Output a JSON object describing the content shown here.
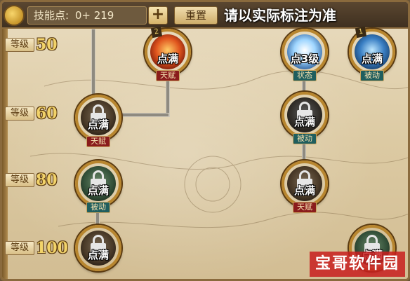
{
  "header": {
    "skill_points_label": "技能点:",
    "skill_points_value": "0+ 219",
    "plus_label": "+",
    "reset_label": "重置",
    "note": "请以实际标注为准"
  },
  "levels": [
    {
      "tag": "等级",
      "value": "50"
    },
    {
      "tag": "等级",
      "value": "60"
    },
    {
      "tag": "等级",
      "value": "80"
    },
    {
      "tag": "等级",
      "value": "100"
    }
  ],
  "skills": [
    {
      "id": "fire-talent",
      "label": "点满",
      "type": "天赋",
      "rank": "2",
      "icon": "fire-icon"
    },
    {
      "id": "ice-state",
      "label": "点3级",
      "type": "状态",
      "rank": "",
      "icon": "ice-burst-icon"
    },
    {
      "id": "blue-passive",
      "label": "点满",
      "type": "被动",
      "rank": "1",
      "icon": "blue-slash-icon"
    },
    {
      "id": "lv60-talent",
      "label": "点满",
      "type": "天赋",
      "rank": "",
      "icon": "lock-icon"
    },
    {
      "id": "lv60-passive",
      "label": "点满",
      "type": "被动",
      "rank": "",
      "icon": "lock-icon"
    },
    {
      "id": "lv80-passive",
      "label": "点满",
      "type": "被动",
      "rank": "",
      "icon": "lock-icon"
    },
    {
      "id": "lv80-talent",
      "label": "点满",
      "type": "天赋",
      "rank": "",
      "icon": "lock-icon"
    },
    {
      "id": "lv100-left",
      "label": "点满",
      "type": "",
      "rank": "",
      "icon": "lock-icon"
    },
    {
      "id": "lv100-right",
      "label": "点满",
      "type": "",
      "rank": "",
      "icon": "lock-icon"
    }
  ],
  "colors": {
    "talent_badge": "#8a1c1c",
    "passive_badge": "#1f5e5e",
    "level_number": "#f2d36a"
  },
  "watermark": "宝哥软件园"
}
